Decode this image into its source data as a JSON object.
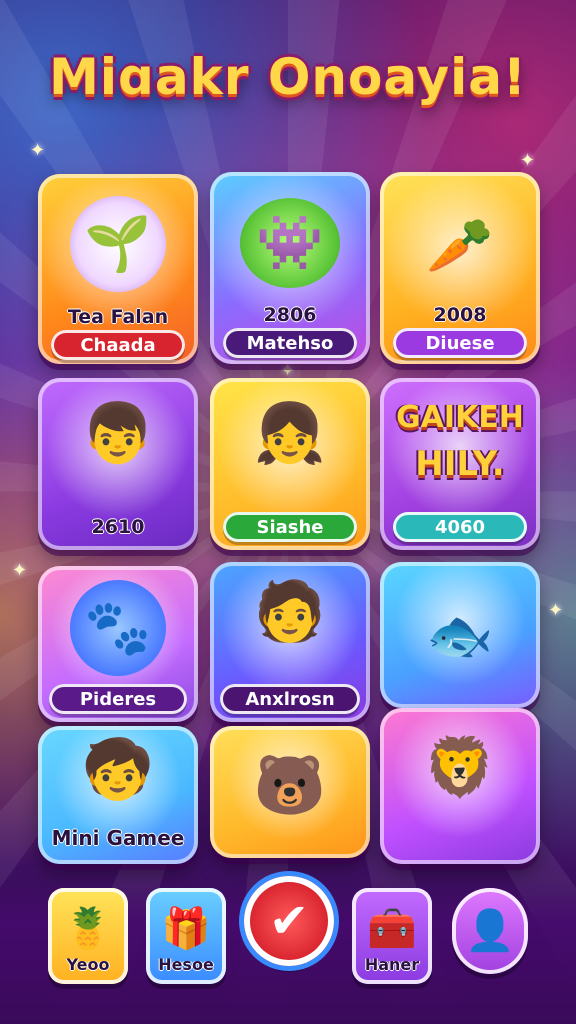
{
  "title": "Miɑakr Onoayia!",
  "cards": [
    {
      "id": "c1",
      "text": "Tea Falan",
      "pill": "Chaada",
      "icon": "plant-creature-icon"
    },
    {
      "id": "c2",
      "text": "2806",
      "pill": "Matehso",
      "icon": "green-monster-icon"
    },
    {
      "id": "c3",
      "text": "2008",
      "pill": "Diuese",
      "icon": "carrot-icon"
    },
    {
      "id": "c4",
      "text": "2610",
      "icon": "hat-boy-icon"
    },
    {
      "id": "c5",
      "pill": "Siashe",
      "icon": "bow-girl-icon"
    },
    {
      "id": "c6",
      "logo_top": "GAIKEH",
      "logo_bottom": "HILY.",
      "pill": "4060",
      "icon": "game-logo-icon"
    },
    {
      "id": "c7",
      "pill": "Pideres",
      "icon": "blue-creature-icon"
    },
    {
      "id": "c8",
      "pill": "Anxlrosn",
      "icon": "purple-hair-boy-icon"
    },
    {
      "id": "c9",
      "icon": "toy-fish-icon"
    },
    {
      "id": "c10",
      "text": "Mini Gamee",
      "icon": "brown-hair-boy-icon"
    },
    {
      "id": "c11",
      "icon": "bear-icon"
    },
    {
      "id": "c12",
      "icon": "lion-icecream-icon"
    }
  ],
  "nav": [
    {
      "label": "Yeoo",
      "icon": "pineapple-icon"
    },
    {
      "label": "Hesoe",
      "icon": "gift-box-icon"
    },
    {
      "label": "",
      "icon": "checkmark-icon"
    },
    {
      "label": "Haner",
      "icon": "treasure-chest-icon"
    },
    {
      "label": "",
      "icon": "profile-icon"
    }
  ]
}
